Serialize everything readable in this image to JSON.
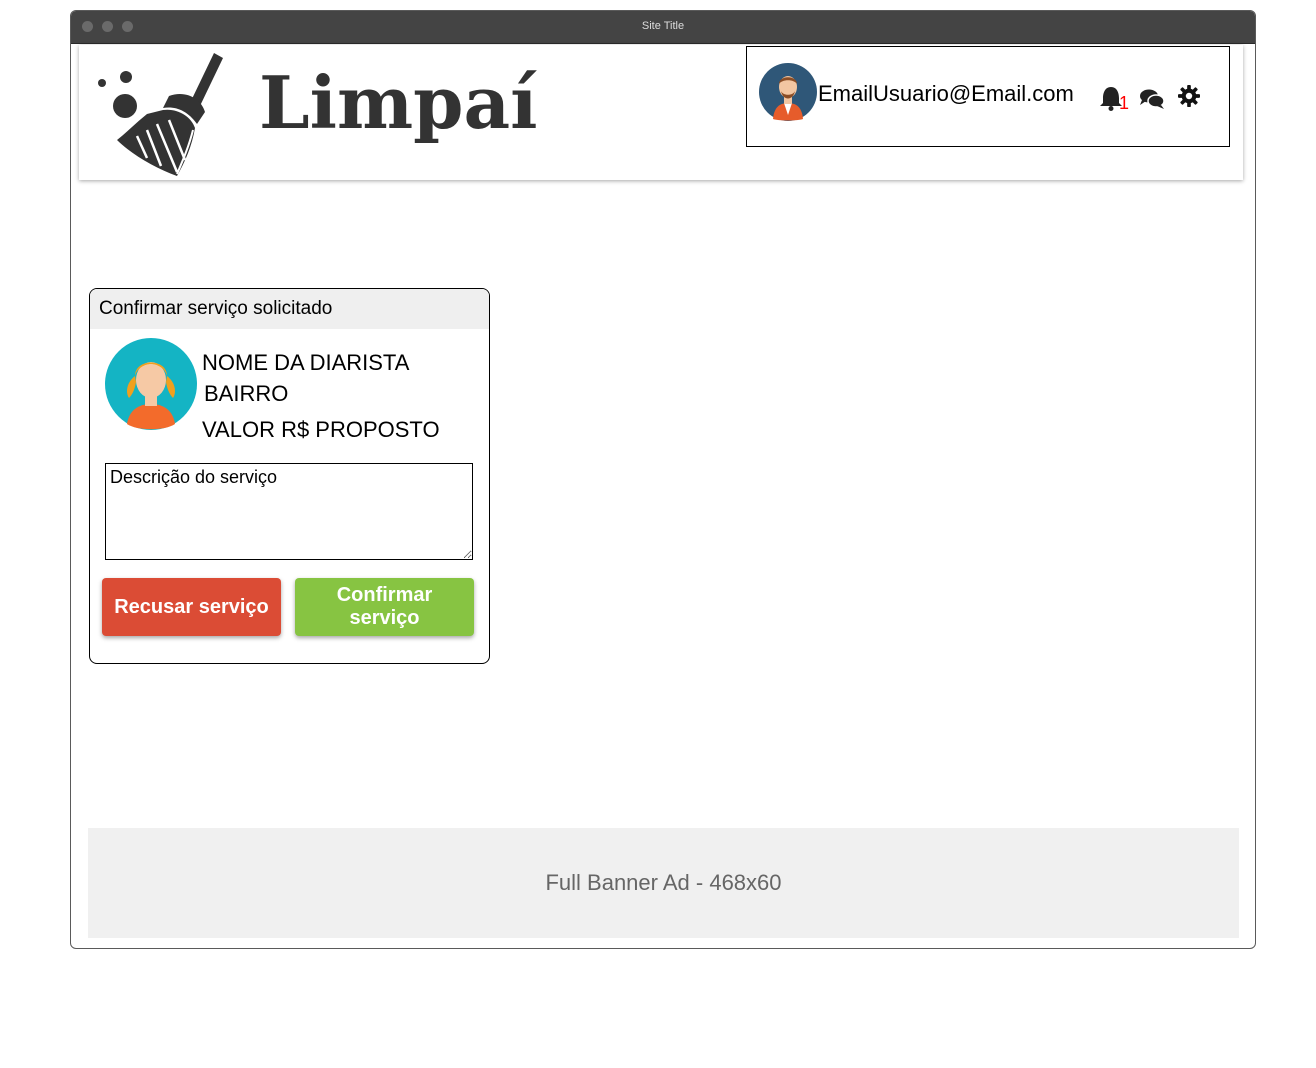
{
  "window": {
    "title": "Site Title"
  },
  "header": {
    "logo_text": "Limpaí",
    "user": {
      "email": "EmailUsuario@Email.com",
      "notification_count": "1"
    },
    "icons": [
      "broom-logo-icon",
      "user-avatar",
      "bell-icon",
      "chat-icon",
      "gear-icon"
    ]
  },
  "card": {
    "title": "Confirmar serviço solicitado",
    "diarista_name": "NOME DA DIARISTA",
    "bairro": "BAIRRO",
    "valor": "VALOR R$ PROPOSTO",
    "description_placeholder": "Descrição do serviço",
    "reject_label": "Recusar serviço",
    "confirm_label": "Confirmar serviço"
  },
  "ad": {
    "label": "Full Banner Ad - 468x60"
  },
  "colors": {
    "reject": "#db4c35",
    "confirm": "#87c442",
    "notification": "#ff0000",
    "titlebar": "#444444"
  }
}
